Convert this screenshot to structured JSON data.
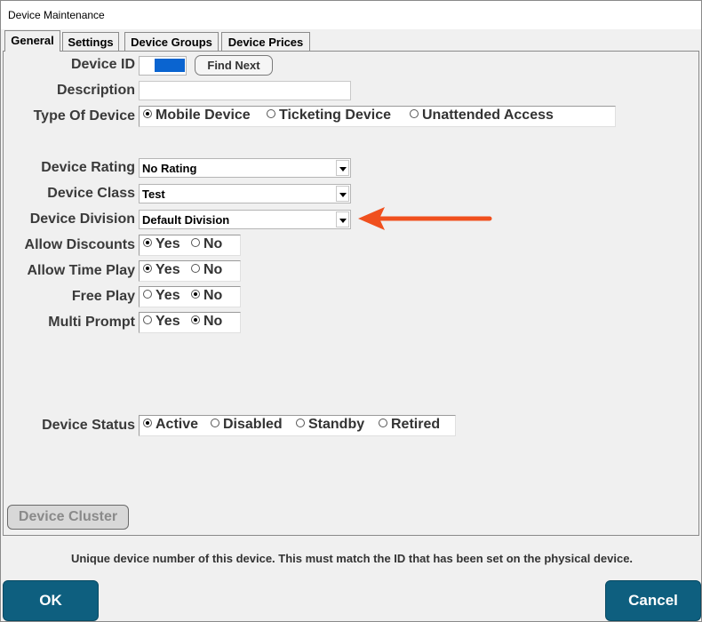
{
  "window": {
    "title": "Device Maintenance"
  },
  "tabs": [
    {
      "label": "General"
    },
    {
      "label": "Settings"
    },
    {
      "label": "Device Groups"
    },
    {
      "label": "Device Prices"
    }
  ],
  "fields": {
    "device_id": {
      "label": "Device ID",
      "find_next": "Find Next"
    },
    "description": {
      "label": "Description",
      "value": ""
    },
    "type_of_device": {
      "label": "Type Of Device",
      "options": [
        "Mobile Device",
        "Ticketing Device",
        "Unattended Access"
      ],
      "selected": "Mobile Device"
    },
    "device_rating": {
      "label": "Device Rating",
      "value": "No Rating"
    },
    "device_class": {
      "label": "Device Class",
      "value": "Test"
    },
    "device_division": {
      "label": "Device Division",
      "value": "Default Division"
    },
    "allow_discounts": {
      "label": "Allow Discounts",
      "yes": "Yes",
      "no": "No",
      "selected": "Yes"
    },
    "allow_time_play": {
      "label": "Allow Time Play",
      "yes": "Yes",
      "no": "No",
      "selected": "Yes"
    },
    "free_play": {
      "label": "Free Play",
      "yes": "Yes",
      "no": "No",
      "selected": "No"
    },
    "multi_prompt": {
      "label": "Multi Prompt",
      "yes": "Yes",
      "no": "No",
      "selected": "No"
    },
    "device_status": {
      "label": "Device Status",
      "options": [
        "Active",
        "Disabled",
        "Standby",
        "Retired"
      ],
      "selected": "Active"
    }
  },
  "buttons": {
    "device_cluster": "Device Cluster",
    "ok": "OK",
    "cancel": "Cancel"
  },
  "hint": "Unique device number of this device.  This must match the ID that has been set on the physical device.",
  "colors": {
    "selection_blue": "#0a64d0",
    "footer_button": "#0e5f7f",
    "annotation_arrow": "#f0501e"
  }
}
